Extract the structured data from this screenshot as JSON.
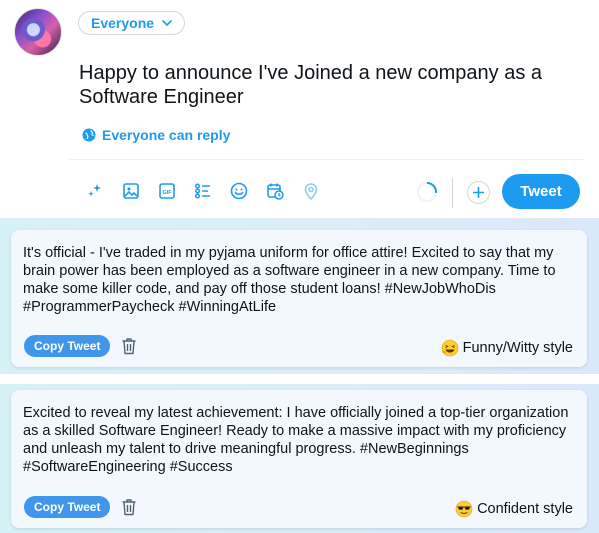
{
  "composer": {
    "audience_label": "Everyone",
    "tweet_text": "Happy to announce I've Joined a new company as a Software Engineer",
    "reply_setting": "Everyone can reply",
    "toolbar": {
      "icons": [
        "sparkle-icon",
        "image-icon",
        "gif-icon",
        "poll-icon",
        "emoji-icon",
        "schedule-icon",
        "location-icon"
      ],
      "tweet_button": "Tweet"
    }
  },
  "suggestions": [
    {
      "text": "It's official - I've traded in my pyjama uniform for office attire! Excited to say that my brain power has been employed as a software engineer in a new company. Time to make some killer code, and pay off those student loans! #NewJobWhoDis #ProgrammerPaycheck #WinningAtLife",
      "copy_label": "Copy Tweet",
      "style_label": "Funny/Witty style",
      "style_emoji": "grinning-squinting-face"
    },
    {
      "text": "Excited to reveal my latest achievement: I have officially joined a top-tier organization as a skilled Software Engineer! Ready to make a massive impact with my proficiency and unleash my talent to drive meaningful progress. #NewBeginnings #SoftwareEngineering #Success",
      "copy_label": "Copy Tweet",
      "style_label": "Confident style",
      "style_emoji": "sunglasses-face"
    }
  ],
  "colors": {
    "accent": "#1d9bf0",
    "copy_button": "#3f96ea",
    "card_bg": "#f3f8ff"
  }
}
